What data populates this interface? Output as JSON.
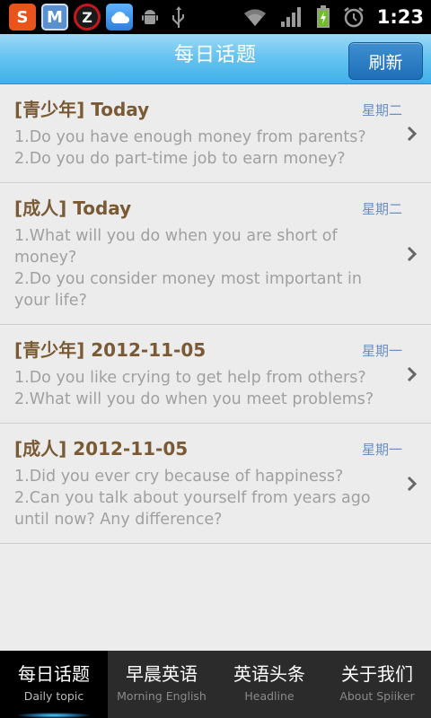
{
  "status_bar": {
    "apps": [
      {
        "name": "sogou-app-icon",
        "glyph": "S"
      },
      {
        "name": "m-app-icon",
        "glyph": "M"
      },
      {
        "name": "z-app-icon",
        "glyph": "Z"
      },
      {
        "name": "cloud-app-icon",
        "glyph": ""
      }
    ],
    "time": "1:23"
  },
  "header": {
    "title": "每日话题",
    "refresh_label": "刷新"
  },
  "topics": [
    {
      "title": "[青少年] Today",
      "day": "星期二",
      "lines": [
        "1.Do you have enough money from parents?",
        "2.Do you do part-time job to earn money?"
      ]
    },
    {
      "title": "[成人] Today",
      "day": "星期二",
      "lines": [
        "1.What will you do when you are short of money?",
        "2.Do you consider money most important in your life?"
      ]
    },
    {
      "title": "[青少年] 2012-11-05",
      "day": "星期一",
      "lines": [
        "1.Do you like crying to get help from others?",
        "2.What will you do when you meet problems?"
      ]
    },
    {
      "title": "[成人] 2012-11-05",
      "day": "星期一",
      "lines": [
        "1.Did you ever cry because of happiness?",
        "2.Can you talk about yourself from years ago until now? Any difference?"
      ]
    }
  ],
  "bottom_nav": [
    {
      "cn": "每日话题",
      "en": "Daily topic",
      "active": true
    },
    {
      "cn": "早晨英语",
      "en": "Morning English",
      "active": false
    },
    {
      "cn": "英语头条",
      "en": "Headline",
      "active": false
    },
    {
      "cn": "关于我们",
      "en": "About Spiiker",
      "active": false
    }
  ]
}
